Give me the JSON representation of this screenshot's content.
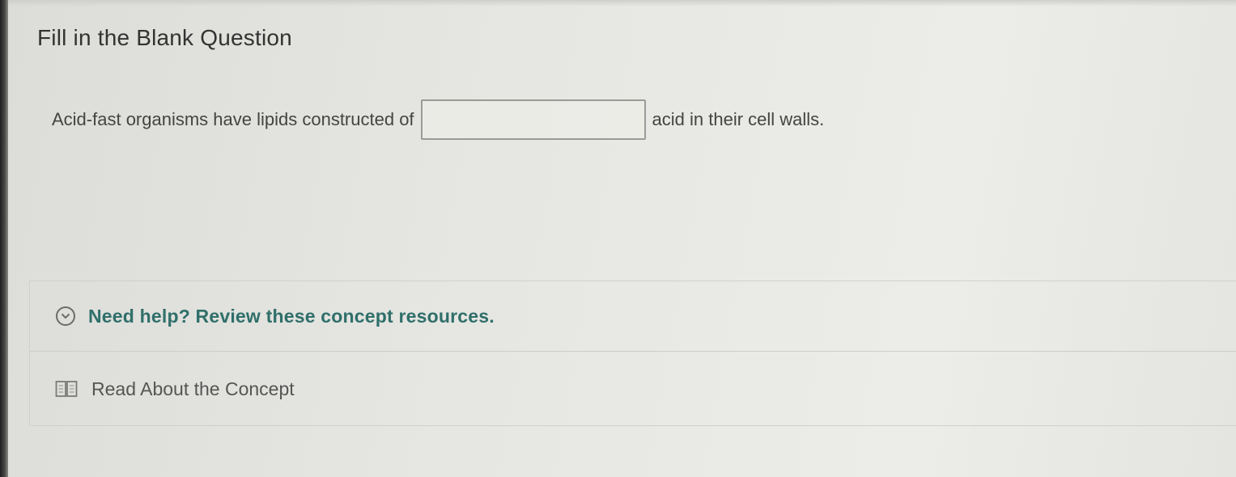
{
  "title": "Fill in the Blank Question",
  "question": {
    "before_blank": "Acid-fast organisms have lipids constructed of",
    "blank_value": "",
    "after_blank": "acid in their cell walls."
  },
  "help": {
    "toggle_label": "Need help? Review these concept resources.",
    "toggle_icon": "chevron-down-icon",
    "resources": [
      {
        "label": "Read About the Concept",
        "icon": "book-icon"
      }
    ]
  },
  "colors": {
    "accent": "#2f6f6a",
    "text": "#3c3c3c",
    "background": "#e6e6e2"
  }
}
